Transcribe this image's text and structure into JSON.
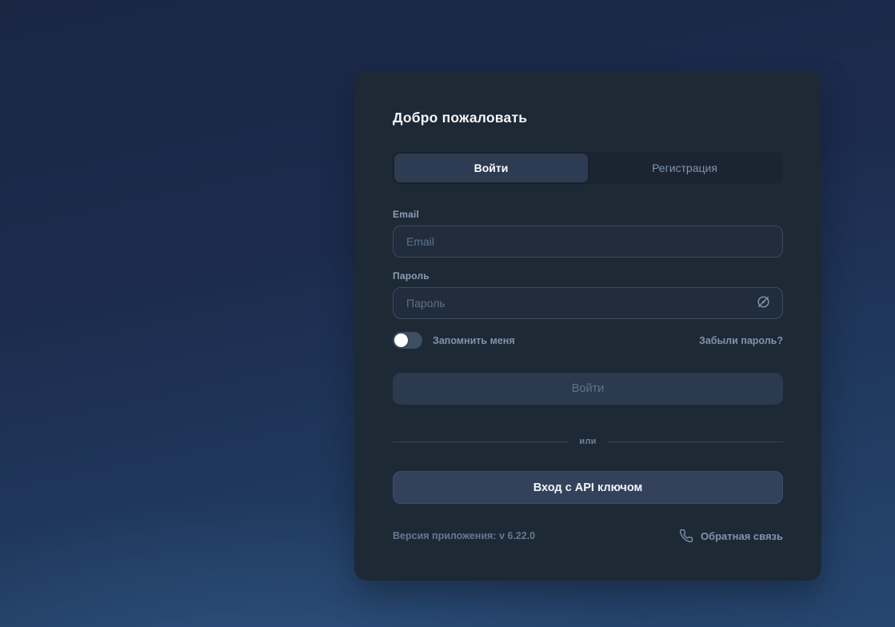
{
  "card": {
    "title": "Добро пожаловать"
  },
  "tabs": {
    "login_label": "Войти",
    "register_label": "Регистрация",
    "active_tab": "login"
  },
  "form": {
    "email_label": "Email",
    "email_placeholder": "Email",
    "email_value": "",
    "password_label": "Пароль",
    "password_placeholder": "Пароль",
    "password_value": "",
    "remember_label": "Запомнить меня",
    "remember_checked": false,
    "forgot_link_label": "Забыли пароль?",
    "submit_label": "Войти",
    "divider_label": "или",
    "api_button_label": "Вход с API ключом"
  },
  "footer": {
    "version_text": "Версия приложения: v 6.22.0",
    "feedback_label": "Обратная связь"
  },
  "icons": {
    "password_toggle": "eye-off-icon",
    "feedback": "phone-icon"
  },
  "colors": {
    "background_top": "#1a2644",
    "background_bottom": "#264670",
    "card_background": "#1e2936",
    "tabbar_background": "#1b2531",
    "active_tab_background": "#2d3c52",
    "input_background": "#212d3d",
    "input_border": "#3b4b60",
    "muted_text": "#7e93ad",
    "primary_text": "#f4f6f9",
    "disabled_button_background": "#2b3a4e",
    "api_button_background": "#33425a"
  }
}
